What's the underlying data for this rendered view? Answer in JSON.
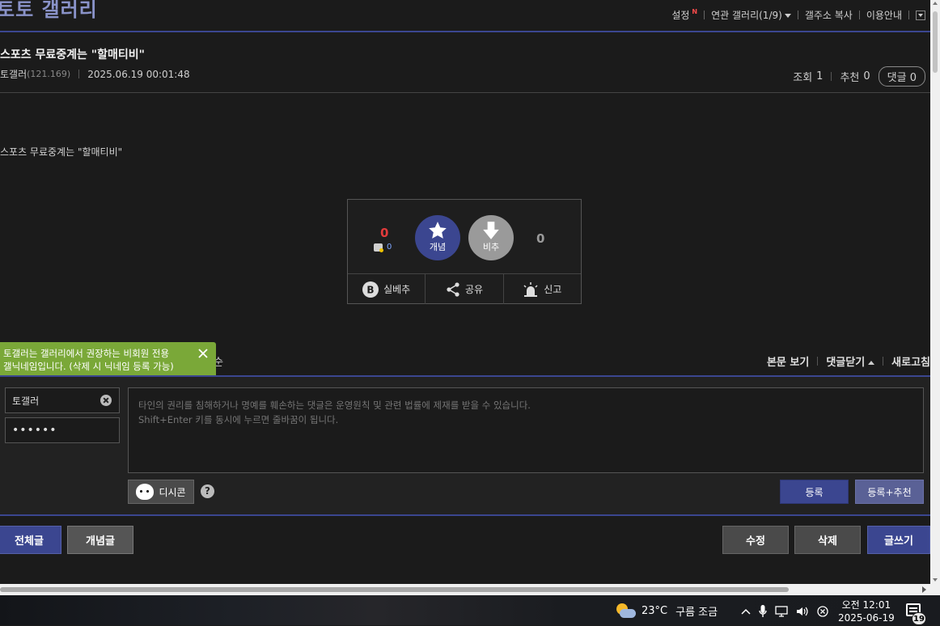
{
  "gallery": {
    "title": "토토 갤러리"
  },
  "top_menu": {
    "settings": "설정",
    "settings_badge": "N",
    "related": "연관 갤러리(1/9)",
    "copy_address": "갤주소 복사",
    "guide": "이용안내"
  },
  "post": {
    "title": "스포츠 무료중계는 \"할매티비\"",
    "author": "토갤러",
    "author_ip": "(121.169)",
    "datetime": "2025.06.19 00:01:48",
    "views_label": "조회",
    "views": "1",
    "recommend_label": "추천",
    "recommend": "0",
    "comments_label": "댓글",
    "comments": "0",
    "body": "스포츠 무료중계는 \"할매티비\""
  },
  "recommend_box": {
    "up_count": "0",
    "fix_count": "0",
    "up_label": "개념",
    "down_label": "비추",
    "down_count": "0",
    "actions": [
      "실베추",
      "공유",
      "신고"
    ]
  },
  "tooltip": {
    "line1": "토갤러는 갤러리에서 권장하는 비회원 전용",
    "line2": "갤닉네임입니다. (삭제 시 닉네임 등록 가능)",
    "behind": "순"
  },
  "comment_menu": {
    "view_body": "본문 보기",
    "close_comments": "댓글닫기",
    "refresh": "새로고침"
  },
  "comment_form": {
    "nickname": "토갤러",
    "password": "••••••",
    "placeholder": "타인의 권리를 침해하거나 명예를 훼손하는 댓글은 운영원칙 및 관련 법률에 제재를 받을 수 있습니다.\nShift+Enter 키를 동시에 누르면 줄바꿈이 됩니다.",
    "dccon": "디시콘",
    "help": "?",
    "submit": "등록",
    "submit_recommend": "등록+추천"
  },
  "bottom_buttons": {
    "all_posts": "전체글",
    "recommended": "개념글",
    "edit": "수정",
    "delete": "삭제",
    "write": "글쓰기"
  },
  "taskbar": {
    "temperature": "23°C",
    "weather": "구름 조금",
    "time": "오전 12:01",
    "date": "2025-06-19",
    "notifications": "19"
  },
  "colors": {
    "background": "#1b1b1b",
    "accent": "#3b4690",
    "tooltip": "#7aa838",
    "up_count": "#e23b3b"
  }
}
